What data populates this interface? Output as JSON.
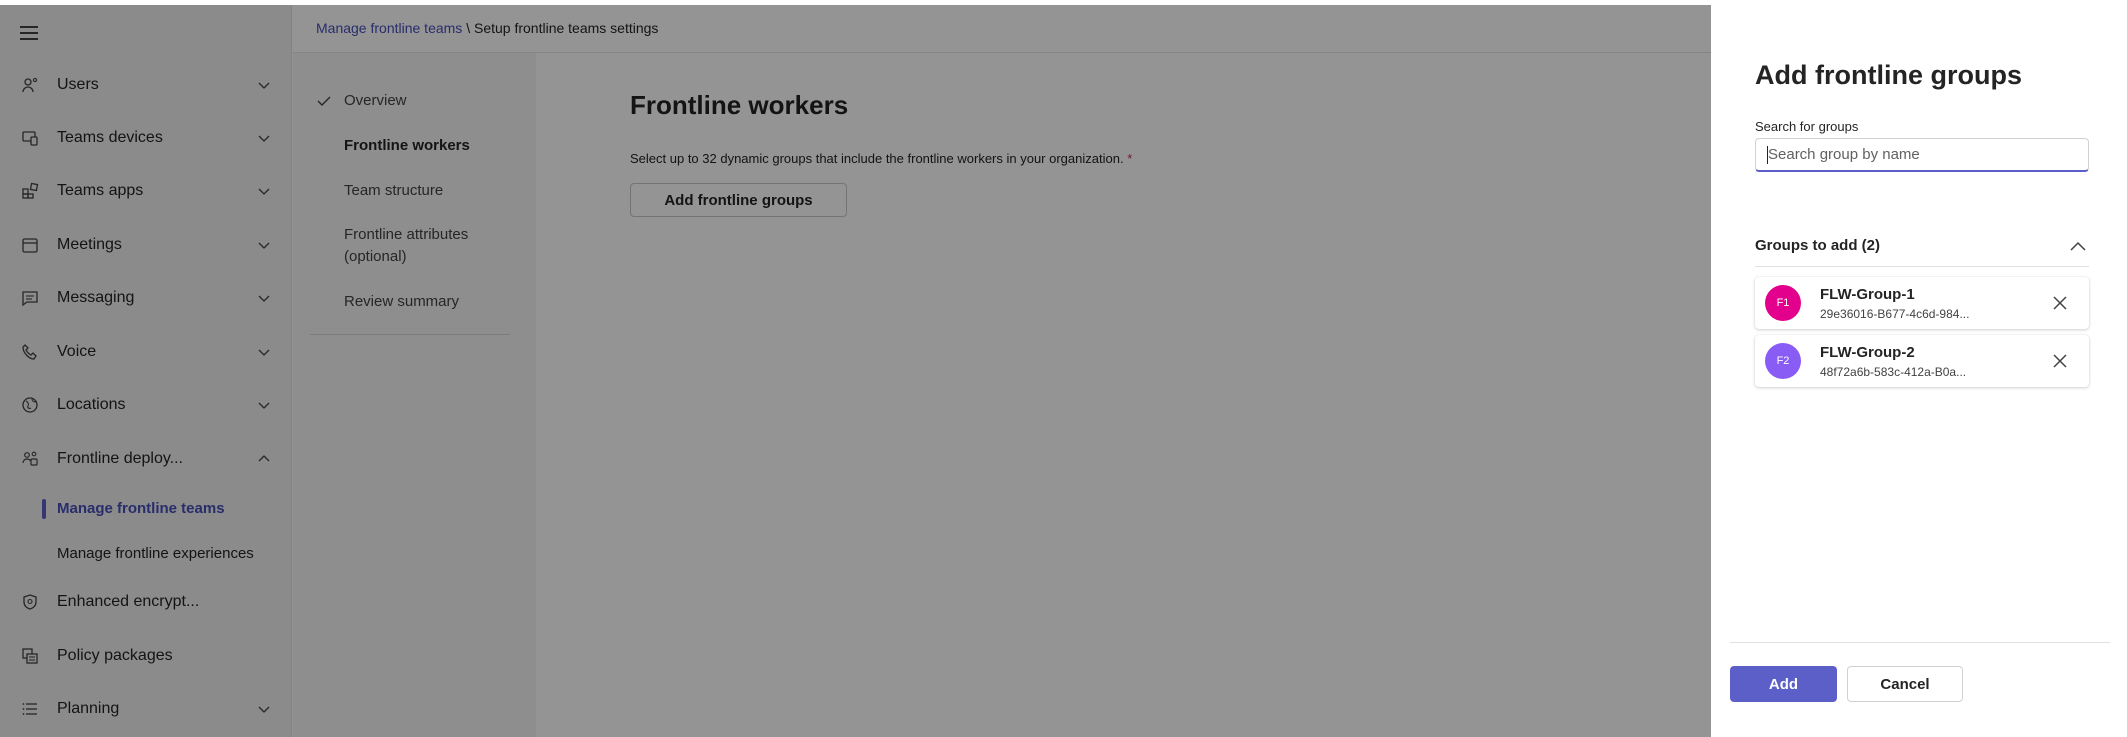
{
  "breadcrumb": {
    "link": "Manage frontline teams",
    "separator": " \\ ",
    "current": "Setup frontline teams settings"
  },
  "nav": {
    "menu_icon": "hamburger-icon",
    "items": [
      {
        "label": "Users",
        "icon": "users-icon",
        "expandable": true
      },
      {
        "label": "Teams devices",
        "icon": "devices-icon",
        "expandable": true
      },
      {
        "label": "Teams apps",
        "icon": "apps-icon",
        "expandable": true
      },
      {
        "label": "Meetings",
        "icon": "calendar-icon",
        "expandable": true
      },
      {
        "label": "Messaging",
        "icon": "chat-icon",
        "expandable": true
      },
      {
        "label": "Voice",
        "icon": "phone-icon",
        "expandable": true
      },
      {
        "label": "Locations",
        "icon": "globe-icon",
        "expandable": true
      },
      {
        "label": "Frontline deploy...",
        "icon": "frontline-icon",
        "expanded": true
      },
      {
        "label": "Enhanced encrypt...",
        "icon": "shield-icon",
        "expandable": false
      },
      {
        "label": "Policy packages",
        "icon": "packages-icon",
        "expandable": false
      },
      {
        "label": "Planning",
        "icon": "list-icon",
        "expandable": true
      }
    ],
    "subitems": [
      {
        "label": "Manage frontline teams",
        "active": true
      },
      {
        "label": "Manage frontline experiences",
        "active": false
      }
    ]
  },
  "steps": [
    {
      "label": "Overview",
      "done": true
    },
    {
      "label": "Frontline workers",
      "current": true
    },
    {
      "label": "Team structure"
    },
    {
      "label": "Frontline attributes",
      "label2": "(optional)"
    },
    {
      "label": "Review summary"
    }
  ],
  "main": {
    "title": "Frontline workers",
    "description": "Select up to 32 dynamic groups that include the frontline workers in your organization.",
    "required_mark": "*",
    "add_button": "Add frontline groups"
  },
  "panel": {
    "title": "Add frontline groups",
    "search_label": "Search for groups",
    "search_placeholder": "Search group by name",
    "search_value": "",
    "section_title": "Groups to add (2)",
    "groups": [
      {
        "initials": "F1",
        "name": "FLW-Group-1",
        "id": "29e36016-B677-4c6d-984...",
        "color": "#e3008c"
      },
      {
        "initials": "F2",
        "name": "FLW-Group-2",
        "id": "48f72a6b-583c-412a-B0a...",
        "color": "#8a5cf6"
      }
    ],
    "primary_button": "Add",
    "secondary_button": "Cancel"
  },
  "colors": {
    "accent": "#5b5fc7",
    "link": "#464eb8",
    "required": "#c4314b"
  }
}
